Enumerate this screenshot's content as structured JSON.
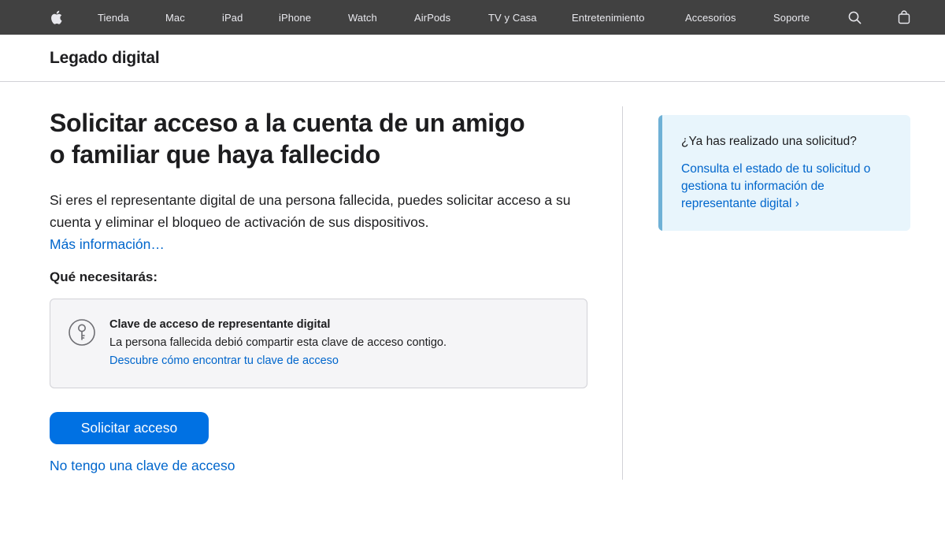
{
  "globalnav": {
    "items": [
      {
        "label": "Tienda"
      },
      {
        "label": "Mac"
      },
      {
        "label": "iPad"
      },
      {
        "label": "iPhone"
      },
      {
        "label": "Watch"
      },
      {
        "label": "AirPods"
      },
      {
        "label": "TV y Casa"
      },
      {
        "label": "Entretenimiento"
      },
      {
        "label": "Accesorios"
      },
      {
        "label": "Soporte"
      }
    ],
    "icons": [
      "apple-logo-icon",
      "search-icon",
      "shopping-bag-icon"
    ]
  },
  "localnav": {
    "title": "Legado digital"
  },
  "main": {
    "headline_line1": "Solicitar acceso a la cuenta de un amigo",
    "headline_line2": "o familiar que haya fallecido",
    "intro": "Si eres el representante digital de una persona fallecida, puedes solicitar acceso a su cuenta y eliminar el bloqueo de activación de sus dispositivos.",
    "more_link": "Más información…",
    "need_label": "Qué necesitarás:",
    "requirement": {
      "icon": "key-icon",
      "title": "Clave de acceso de representante digital",
      "description": "La persona fallecida debió compartir esta clave de acceso contigo.",
      "link": "Descubre cómo encontrar tu clave de acceso"
    },
    "primary_button": "Solicitar acceso",
    "secondary_link": "No tengo una clave de acceso"
  },
  "sidebar": {
    "question": "¿Ya has realizado una solicitud?",
    "link": "Consulta el estado de tu solicitud o gestiona tu información de representante digital ›"
  },
  "colors": {
    "nav_bg": "#414141",
    "link": "#0066cc",
    "button": "#0071e3",
    "side_card_bg": "#e8f5fc",
    "side_card_accent": "#6fb1d6"
  }
}
